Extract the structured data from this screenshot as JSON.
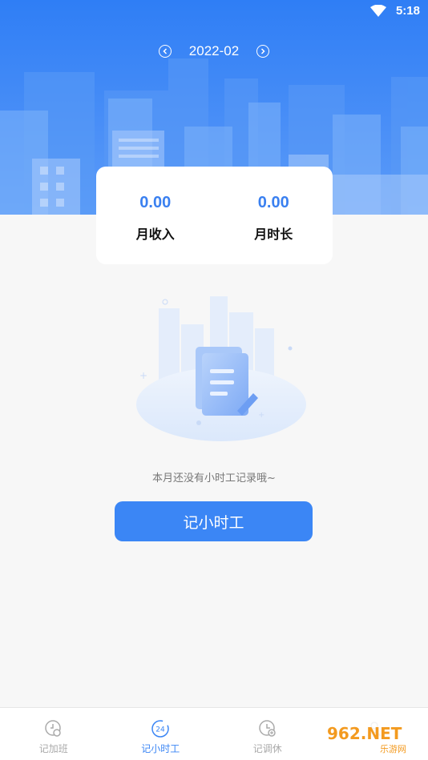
{
  "status_bar": {
    "time": "5:18"
  },
  "month_nav": {
    "label": "2022-02"
  },
  "stats": [
    {
      "value": "0.00",
      "label": "月收入"
    },
    {
      "value": "0.00",
      "label": "月时长"
    }
  ],
  "empty_state": {
    "text": "本月还没有小时工记录哦~"
  },
  "record_button": {
    "label": "记小时工"
  },
  "tabs": [
    {
      "label": "记加班",
      "icon": "overtime-icon"
    },
    {
      "label": "记小时工",
      "icon": "hourly-24-icon"
    },
    {
      "label": "记调休",
      "icon": "leave-clock-icon"
    },
    {
      "label": "",
      "icon": "profile-icon"
    }
  ],
  "watermark": {
    "text": "962.NET",
    "subtext": "乐游网"
  },
  "colors": {
    "primary": "#3b86f5",
    "header": "#2f7ef5",
    "value": "#3a80f0"
  }
}
